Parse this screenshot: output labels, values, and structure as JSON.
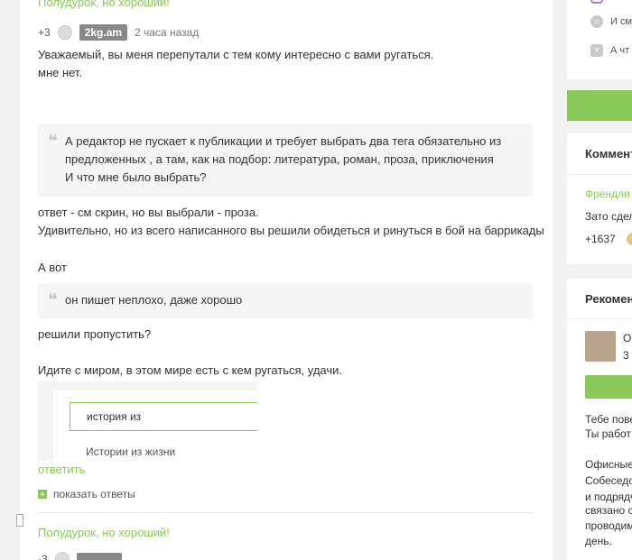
{
  "comment": {
    "top_title": "Полудурок, но хороший!",
    "rating": "+3",
    "username": "2kg.am",
    "time": "2 часа назад",
    "line1": "Уважаемый, вы меня перепутали с тем кому интересно с вами ругаться.",
    "line2": "мне нет.",
    "quote1_line1": "А редактор не пускает к публикации и требует выбрать два тега обязательно из",
    "quote1_line2": "предложенных , а там, как на подбор: литература, роман, проза, приключения",
    "quote1_line3": "И что мне было выбрать?",
    "line3": "ответ - см скрин, но вы выбрали - проза.",
    "line4": "Удивительно, но из всего написанного вы решили обидеться и ринуться в бой на баррикады",
    "line5": "А вот",
    "quote2": "он пишет неплохо, даже хорошо",
    "line6": "решили пропустить?",
    "line7": "Идите с миром, в этом мире есть с кем ругаться, удачи.",
    "screenshot_input": "история из",
    "screenshot_item": "Истории из жизни",
    "reply": "ответить",
    "show_replies": "показать ответы",
    "bottom_title": "Полудурок, но хороший!",
    "bottom_rating": "-3"
  },
  "sidebar": {
    "row1": "И см",
    "row2": "А чт",
    "comments_head": "Коммент",
    "comments_link": "Френдли",
    "comments_text": "Зато сдел",
    "comments_rating": "+1637",
    "recommend_head": "Рекомен",
    "rec_name": "Ос",
    "rec_time": "3",
    "rec_text1": "Тебе пове",
    "rec_text2": "Ты работ",
    "rec_text3": "Офисные",
    "rec_text4": "Собеседо",
    "rec_text5": "и подрядч",
    "rec_text6": "связано с",
    "rec_text7": "проводим",
    "rec_text8": "день."
  },
  "colors": {
    "accent": "#8ac858",
    "badge": "#888888"
  }
}
